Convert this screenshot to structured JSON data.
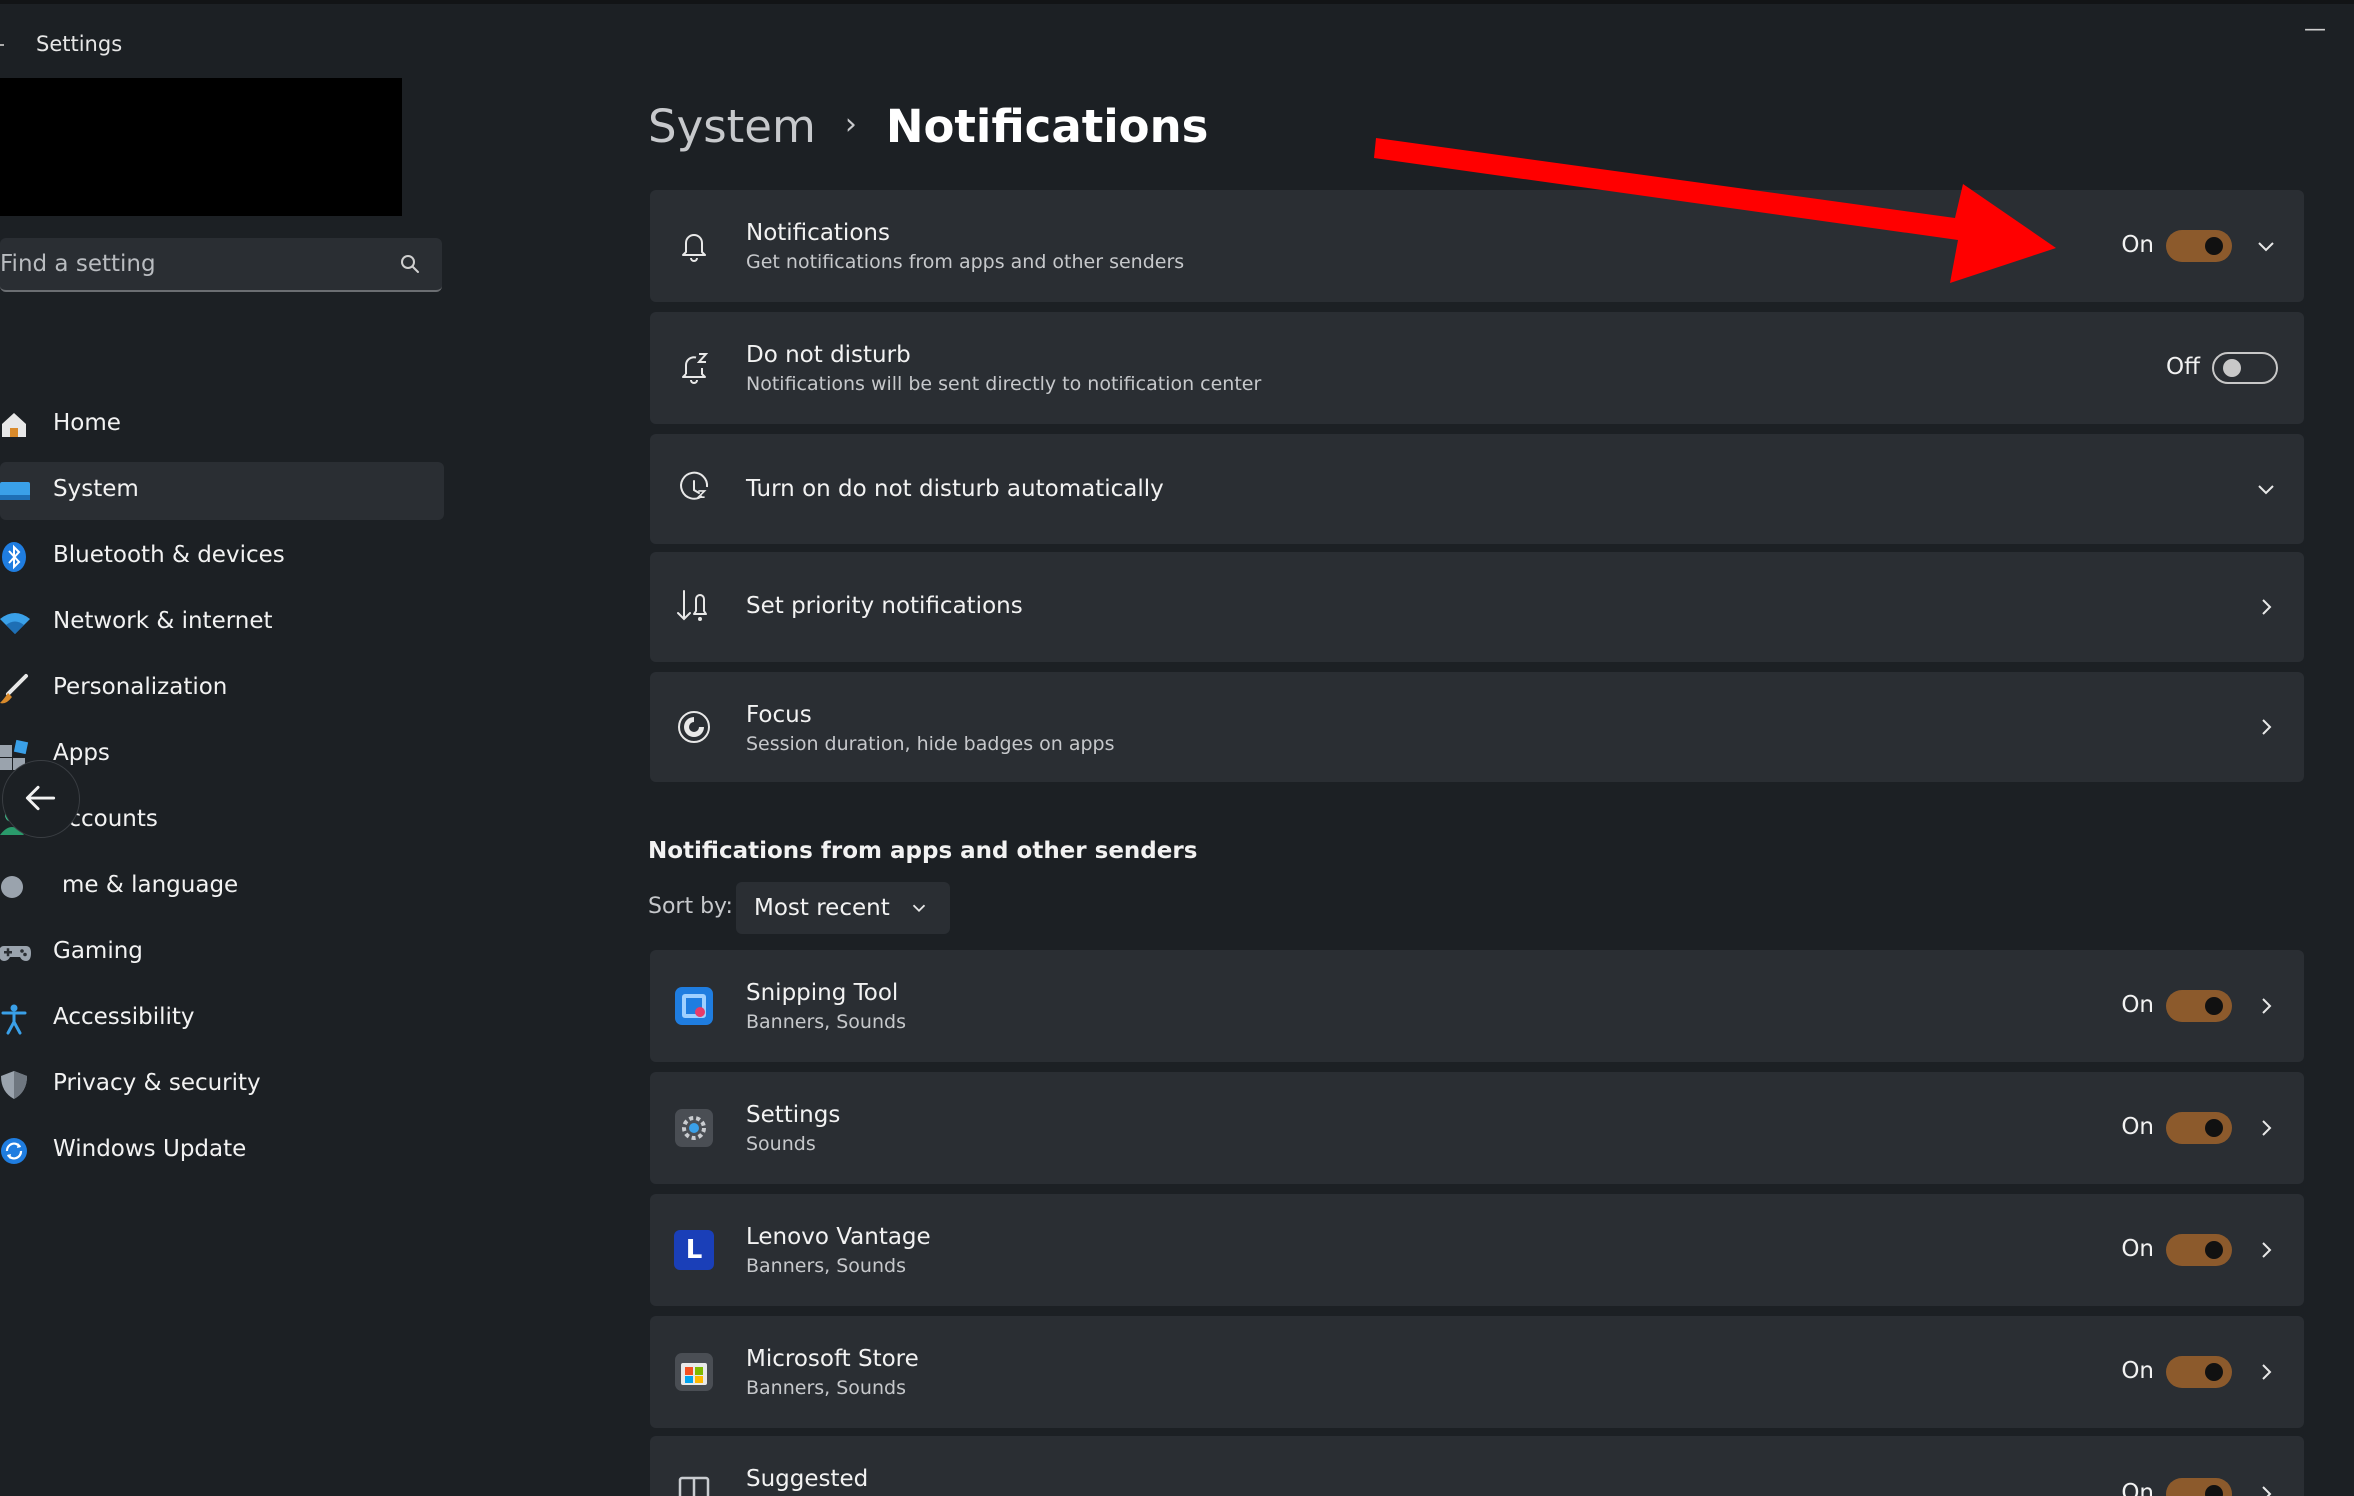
{
  "window": {
    "title": "Settings",
    "minimize_glyph": "—"
  },
  "search": {
    "placeholder": "Find a setting"
  },
  "sidebar": {
    "items": [
      {
        "label": "Home",
        "icon": "home-icon"
      },
      {
        "label": "System",
        "icon": "system-icon",
        "selected": true
      },
      {
        "label": "Bluetooth & devices",
        "icon": "bluetooth-icon"
      },
      {
        "label": "Network & internet",
        "icon": "wifi-icon"
      },
      {
        "label": "Personalization",
        "icon": "brush-icon"
      },
      {
        "label": "Apps",
        "icon": "apps-icon"
      },
      {
        "label": "Accounts",
        "icon": "accounts-icon"
      },
      {
        "label": "me & language",
        "icon": "time-language-icon"
      },
      {
        "label": "Gaming",
        "icon": "gamepad-icon"
      },
      {
        "label": "Accessibility",
        "icon": "accessibility-icon"
      },
      {
        "label": "Privacy & security",
        "icon": "shield-icon"
      },
      {
        "label": "Windows Update",
        "icon": "update-icon"
      }
    ]
  },
  "breadcrumb": {
    "parent": "System",
    "separator": "›",
    "current": "Notifications"
  },
  "settings": {
    "notifications": {
      "title": "Notifications",
      "subtitle": "Get notifications from apps and other senders",
      "state": "On",
      "enabled": true
    },
    "dnd": {
      "title": "Do not disturb",
      "subtitle": "Notifications will be sent directly to notification center",
      "state": "Off",
      "enabled": false
    },
    "auto_dnd": {
      "title": "Turn on do not disturb automatically"
    },
    "priority": {
      "title": "Set priority notifications"
    },
    "focus": {
      "title": "Focus",
      "subtitle": "Session duration, hide badges on apps"
    }
  },
  "apps_section": {
    "title": "Notifications from apps and other senders",
    "sort_label": "Sort by:",
    "sort_value": "Most recent",
    "apps": [
      {
        "name": "Snipping Tool",
        "detail": "Banners, Sounds",
        "state": "On",
        "icon": "snipping-tool-icon"
      },
      {
        "name": "Settings",
        "detail": "Sounds",
        "state": "On",
        "icon": "settings-gear-icon"
      },
      {
        "name": "Lenovo Vantage",
        "detail": "Banners, Sounds",
        "state": "On",
        "icon": "lenovo-vantage-icon",
        "icon_letter": "L"
      },
      {
        "name": "Microsoft Store",
        "detail": "Banners, Sounds",
        "state": "On",
        "icon": "microsoft-store-icon"
      },
      {
        "name": "Suggested",
        "detail": "",
        "state": "On",
        "icon": "suggested-icon"
      }
    ]
  },
  "colors": {
    "accent": "#8c5a2c",
    "annotation_arrow": "#ff0000",
    "background": "#1c2024",
    "card": "#2a2e33"
  }
}
